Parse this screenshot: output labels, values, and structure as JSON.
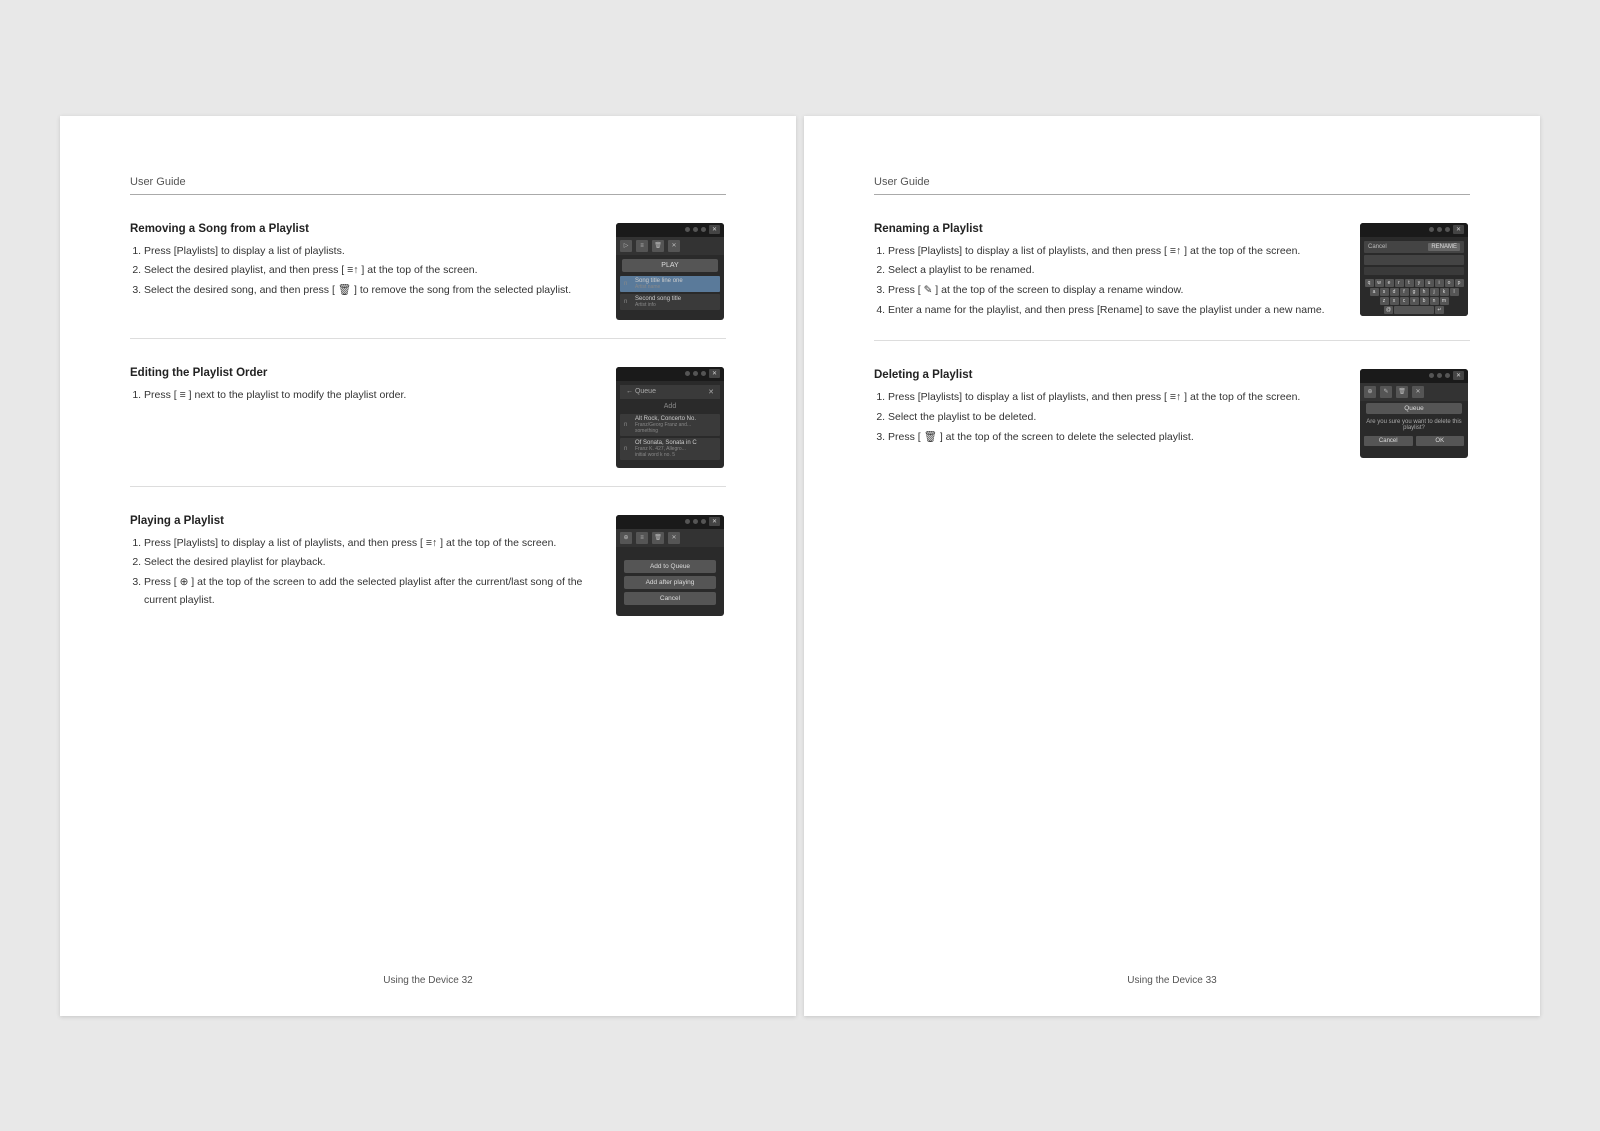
{
  "pages": [
    {
      "header": "User Guide",
      "footer": "Using the Device  32",
      "sections": [
        {
          "id": "removing-song",
          "title": "Removing a Song from a Playlist",
          "steps": [
            "Press [Playlists] to display a list of playlists.",
            "Select the desired playlist, and then press [ ≡↑ ] at the top of the screen.",
            "Select the desired song, and then press [ 🗑 ] to remove the song from the selected playlist."
          ]
        },
        {
          "id": "editing-order",
          "title": "Editing the Playlist Order",
          "steps": [
            "Press [ ≡ ] next to the playlist to modify the playlist order."
          ]
        },
        {
          "id": "playing-playlist",
          "title": "Playing a Playlist",
          "steps": [
            "Press [Playlists] to display a list of playlists, and then press [ ≡↑ ] at the top of the screen.",
            "Select the desired playlist for playback.",
            "Press [ ⊕ ] at the top of the screen to add the selected playlist after the current/last song of the current playlist."
          ]
        }
      ]
    },
    {
      "header": "User Guide",
      "footer": "Using the Device  33",
      "sections": [
        {
          "id": "renaming-playlist",
          "title": "Renaming a Playlist",
          "steps": [
            "Press [Playlists] to display a list of playlists, and then press [ ≡↑ ] at the top of the screen.",
            "Select a playlist to be renamed.",
            "Press [ ✎ ] at the top of the screen to display a rename window.",
            "Enter a name for the playlist, and then press [Rename] to save the playlist under a new name."
          ]
        },
        {
          "id": "deleting-playlist",
          "title": "Deleting a Playlist",
          "steps": [
            "Press [Playlists] to display a list of playlists, and then press [ ≡↑ ] at the top of the screen.",
            "Select the playlist to be deleted.",
            "Press [ 🗑 ] at the top of the screen to delete the selected playlist."
          ]
        }
      ]
    }
  ],
  "keyboard_rows": [
    [
      "q",
      "w",
      "e",
      "r",
      "t",
      "y",
      "u",
      "i",
      "o",
      "p"
    ],
    [
      "a",
      "s",
      "d",
      "f",
      "g",
      "h",
      "j",
      "k",
      "l"
    ],
    [
      "z",
      "x",
      "c",
      "v",
      "b",
      "n",
      "m"
    ]
  ]
}
